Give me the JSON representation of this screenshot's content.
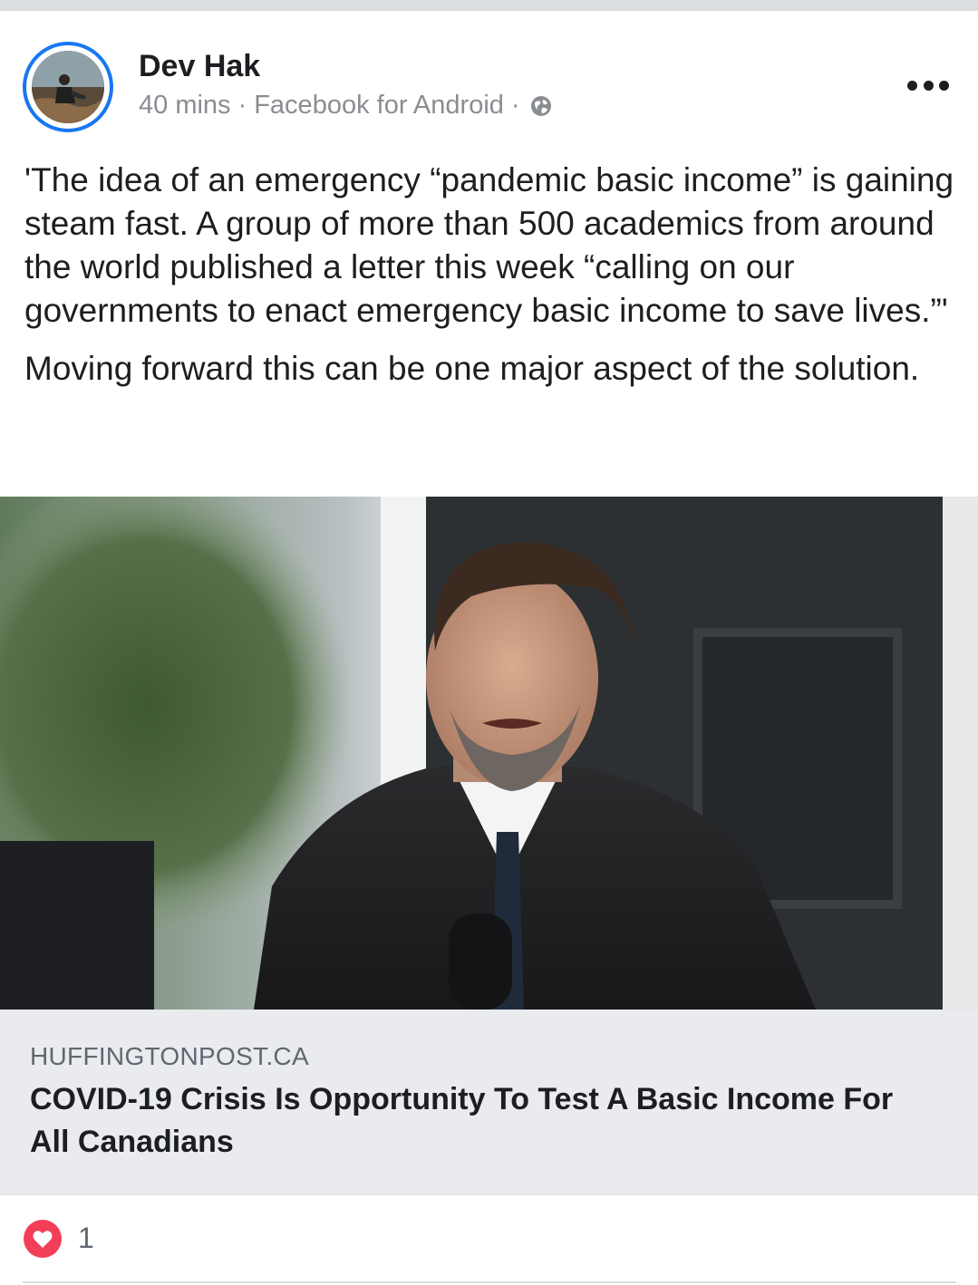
{
  "post": {
    "author": "Dev Hak",
    "time": "40 mins",
    "source": "Facebook for Android",
    "privacy_icon": "globe-icon",
    "paragraphs": [
      "'The idea of an emergency “pandemic basic income” is gaining steam fast. A group of more than 500 academics from around the world published a letter this week “calling on our governments to enact emergency basic income to save lives.”'",
      "Moving forward this can be one major aspect of the solution."
    ]
  },
  "link": {
    "domain": "HUFFINGTONPOST.CA",
    "title": "COVID-19 Crisis Is Opportunity To Test A Basic Income For All Canadians"
  },
  "reactions": {
    "icon": "heart-reaction-icon",
    "count": "1"
  },
  "colors": {
    "accent": "#1877f2",
    "love": "#f33e58",
    "card_bg": "#e9ebee"
  }
}
